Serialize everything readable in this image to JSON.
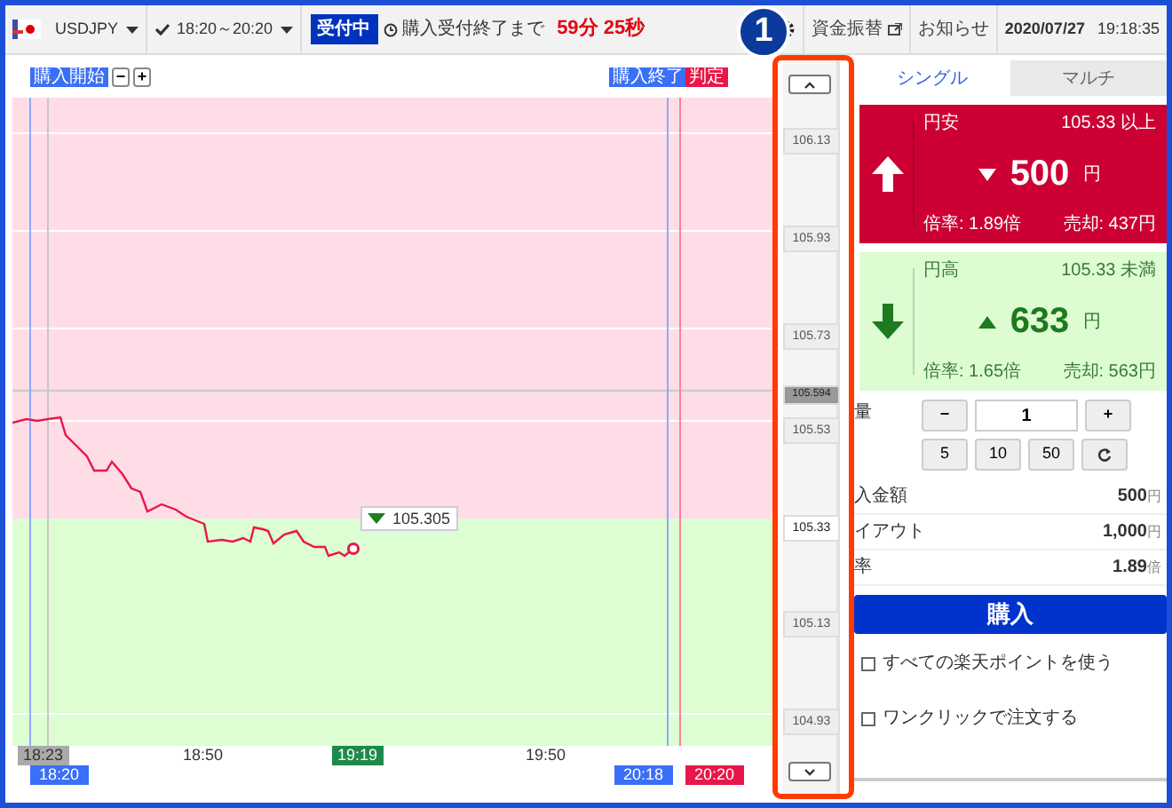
{
  "header": {
    "currency": "USDJPY",
    "session": "18:20～20:20",
    "status_badge": "受付中",
    "countdown_label": "購入受付終了まで",
    "countdown": "59分 25秒",
    "links": [
      {
        "label": "資金振替",
        "external": true
      },
      {
        "label": "お知らせ",
        "external": false
      }
    ],
    "date": "2020/07/27",
    "time": "19:18:35"
  },
  "callout": "1",
  "chart": {
    "markers": [
      {
        "text": "購入開始",
        "kind": "start"
      },
      {
        "text": "購入終了",
        "kind": "end"
      },
      {
        "text": "判定",
        "kind": "judge"
      }
    ],
    "zoom_buttons": [
      "−",
      "+"
    ],
    "current_price": {
      "text": "105.305",
      "falling": true
    },
    "time_labels": [
      {
        "text": "18:23",
        "kind": "first"
      },
      {
        "text": "18:50",
        "kind": "tick"
      },
      {
        "text": "19:19",
        "kind": "now"
      },
      {
        "text": "19:50",
        "kind": "tick"
      }
    ],
    "period_labels": [
      {
        "text": "18:20",
        "kind": "start"
      },
      {
        "text": "20:18",
        "kind": "end"
      },
      {
        "text": "20:20",
        "kind": "judge"
      }
    ]
  },
  "price_scale": [
    {
      "text": "106.13",
      "kind": "tick"
    },
    {
      "text": "105.93",
      "kind": "tick"
    },
    {
      "text": "105.73",
      "kind": "tick"
    },
    {
      "text": "105.594",
      "kind": "current"
    },
    {
      "text": "105.53",
      "kind": "tick"
    },
    {
      "text": "105.33",
      "kind": "strike"
    },
    {
      "text": "105.13",
      "kind": "tick"
    },
    {
      "text": "104.93",
      "kind": "tick"
    }
  ],
  "tabs": [
    {
      "label": "シングル",
      "selected": true
    },
    {
      "label": "マルチ",
      "selected": false
    }
  ],
  "options": [
    {
      "kind": "up",
      "name": "円安",
      "condition": "105.33 以上",
      "falling": true,
      "price": "500",
      "unit": "円",
      "ratio": "倍率: 1.89倍",
      "sell": "売却: 437円"
    },
    {
      "kind": "down",
      "name": "円高",
      "condition": "105.33 未満",
      "falling": false,
      "price": "633",
      "unit": "円",
      "ratio": "倍率: 1.65倍",
      "sell": "売却: 563円"
    }
  ],
  "quantity": {
    "label": "量",
    "minus": "−",
    "value": "1",
    "plus": "+",
    "presets": [
      "5",
      "10",
      "50"
    ]
  },
  "summary": [
    {
      "label": "入金額",
      "value": "500",
      "unit": "円"
    },
    {
      "label": "イアウト",
      "value": "1,000",
      "unit": "円"
    },
    {
      "label": "率",
      "value": "1.89",
      "unit": "倍"
    }
  ],
  "buy_button": "購入",
  "checkboxes": [
    {
      "label": "すべての楽天ポイントを使う",
      "checked": false
    },
    {
      "label": "ワンクリックで注文する",
      "checked": false
    }
  ]
}
